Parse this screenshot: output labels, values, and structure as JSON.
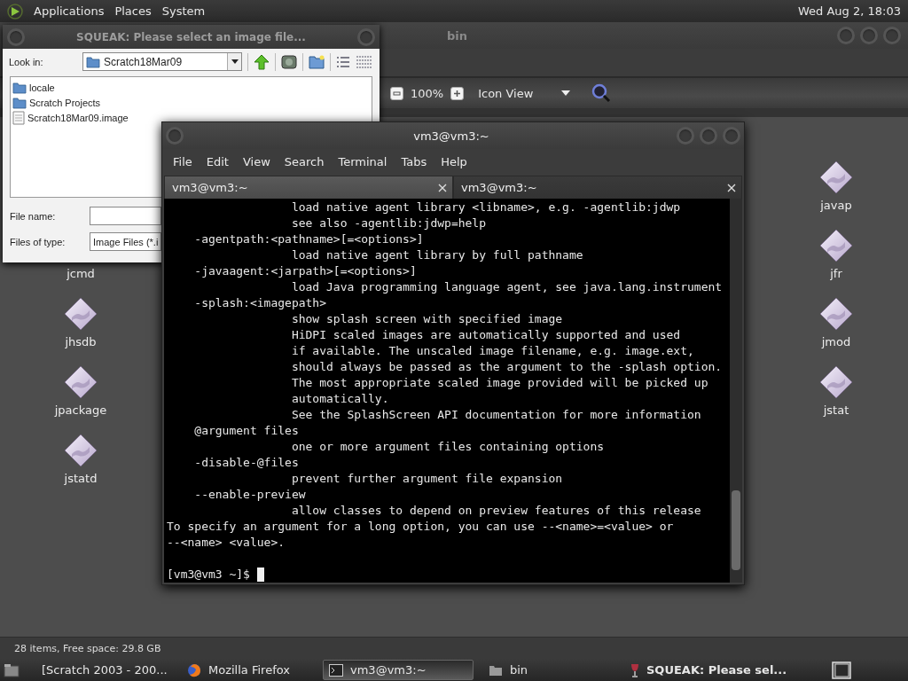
{
  "top_panel": {
    "menus": [
      "Applications",
      "Places",
      "System"
    ],
    "clock": "Wed Aug 2, 18:03"
  },
  "file_manager": {
    "title": "bin",
    "zoom": "100%",
    "view": "Icon View",
    "left_icon_label_only": {
      "label": "jcmd"
    },
    "left_icons": [
      {
        "label": "jhsdb"
      },
      {
        "label": "jpackage"
      },
      {
        "label": "jstatd"
      }
    ],
    "right_icons": [
      {
        "label": "javap"
      },
      {
        "label": "jfr"
      },
      {
        "label": "jmod"
      },
      {
        "label": "jstat"
      }
    ],
    "status": "28 items, Free space: 29.8 GB"
  },
  "file_dialog": {
    "title": "SQUEAK: Please select an image file...",
    "look_in_label": "Look in:",
    "look_in_value": "Scratch18Mar09",
    "files": [
      {
        "name": "locale",
        "kind": "folder"
      },
      {
        "name": "Scratch Projects",
        "kind": "folder"
      },
      {
        "name": "Scratch18Mar09.image",
        "kind": "file"
      }
    ],
    "file_name_label": "File name:",
    "files_of_type_label": "Files of type:",
    "files_of_type_value": "Image Files (*.i"
  },
  "terminal": {
    "title": "vm3@vm3:~",
    "menus": [
      "File",
      "Edit",
      "View",
      "Search",
      "Terminal",
      "Tabs",
      "Help"
    ],
    "tabs": [
      {
        "label": "vm3@vm3:~",
        "selected": false
      },
      {
        "label": "vm3@vm3:~",
        "selected": true
      }
    ],
    "lines": [
      "                  load native agent library <libname>, e.g. -agentlib:jdwp",
      "                  see also -agentlib:jdwp=help",
      "    -agentpath:<pathname>[=<options>]",
      "                  load native agent library by full pathname",
      "    -javaagent:<jarpath>[=<options>]",
      "                  load Java programming language agent, see java.lang.instrument",
      "    -splash:<imagepath>",
      "                  show splash screen with specified image",
      "                  HiDPI scaled images are automatically supported and used",
      "                  if available. The unscaled image filename, e.g. image.ext,",
      "                  should always be passed as the argument to the -splash option.",
      "                  The most appropriate scaled image provided will be picked up",
      "                  automatically.",
      "                  See the SplashScreen API documentation for more information",
      "    @argument files",
      "                  one or more argument files containing options",
      "    -disable-@files",
      "                  prevent further argument file expansion",
      "    --enable-preview",
      "                  allow classes to depend on preview features of this release",
      "To specify an argument for a long option, you can use --<name>=<value> or",
      "--<name> <value>."
    ],
    "prompt": "[vm3@vm3 ~]$"
  },
  "taskbar": {
    "items": [
      {
        "label": "[Scratch 2003 - 200...",
        "kind": "folder",
        "selected": false,
        "urgent": false
      },
      {
        "label": "Mozilla Firefox",
        "kind": "browser",
        "selected": false,
        "urgent": false
      },
      {
        "label": "vm3@vm3:~",
        "kind": "terminal",
        "selected": true,
        "urgent": false
      },
      {
        "label": "bin",
        "kind": "folder",
        "selected": false,
        "urgent": false
      },
      {
        "label": "SQUEAK: Please sel...",
        "kind": "squeak",
        "selected": false,
        "urgent": true
      }
    ]
  }
}
